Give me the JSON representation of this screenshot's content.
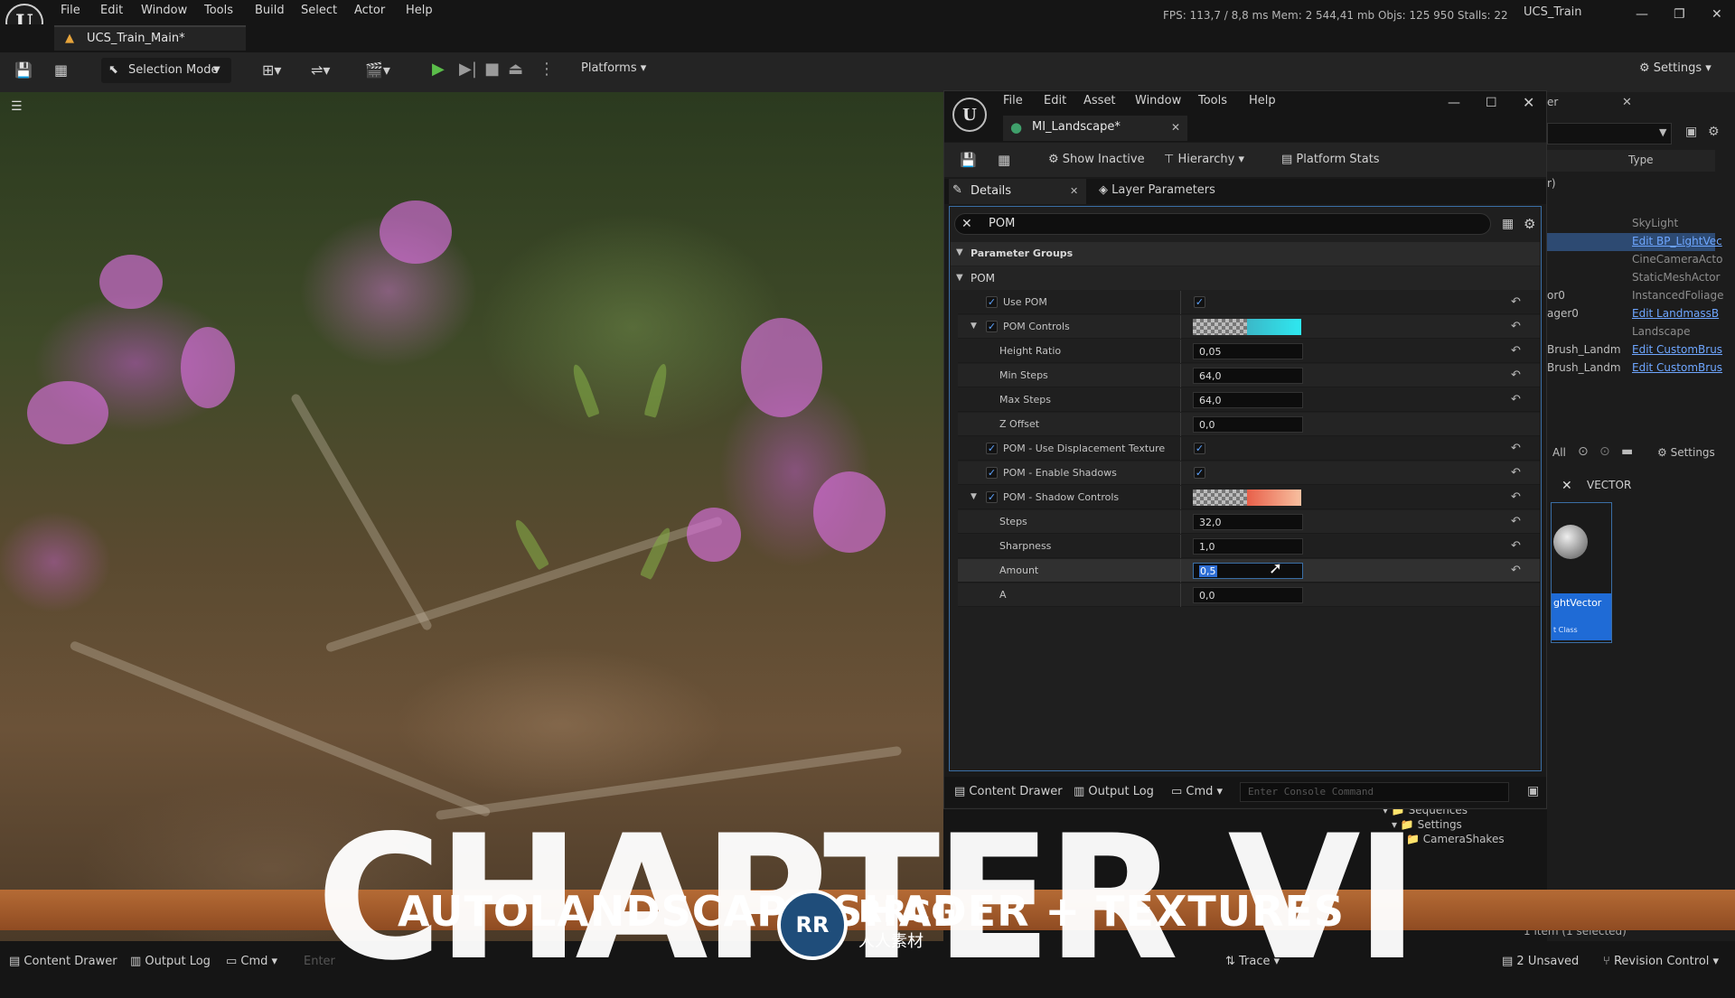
{
  "editor": {
    "menu": [
      "File",
      "Edit",
      "Window",
      "Tools",
      "Build",
      "Select",
      "Actor",
      "Help"
    ],
    "stats": "FPS: 113,7  /  8,8 ms   Mem: 2 544,41 mb   Objs: 125 950   Stalls: 22",
    "project_title": "UCS_Train",
    "level_tab": "UCS_Train_Main*",
    "selection_mode": "Selection Mode",
    "platforms": "Platforms",
    "settings": "Settings"
  },
  "material_editor": {
    "menu": [
      "File",
      "Edit",
      "Asset",
      "Window",
      "Tools",
      "Help"
    ],
    "tab_title": "MI_Landscape*",
    "toolbar": {
      "show_inactive": "Show Inactive",
      "hierarchy": "Hierarchy",
      "platform_stats": "Platform Stats"
    },
    "panel_tabs": {
      "details": "Details",
      "layer_parameters": "Layer Parameters"
    },
    "search": "POM",
    "group_header": "Parameter Groups",
    "group": "POM",
    "params": [
      {
        "label": "Use POM",
        "checked": true,
        "value_checked": true,
        "kind": "bool"
      },
      {
        "label": "POM Controls",
        "checked": true,
        "kind": "color",
        "color": "#23d6e6"
      },
      {
        "label": "Height Ratio",
        "value": "0,05",
        "kind": "num"
      },
      {
        "label": "Min Steps",
        "value": "64,0",
        "kind": "num"
      },
      {
        "label": "Max Steps",
        "value": "64,0",
        "kind": "num"
      },
      {
        "label": "Z Offset",
        "value": "0,0",
        "kind": "num"
      },
      {
        "label": "POM - Use Displacement Texture",
        "checked": true,
        "value_checked": true,
        "kind": "bool"
      },
      {
        "label": "POM - Enable Shadows",
        "checked": true,
        "value_checked": true,
        "kind": "bool"
      },
      {
        "label": "POM - Shadow Controls",
        "checked": true,
        "kind": "color",
        "color": "#f08060"
      },
      {
        "label": "Steps",
        "value": "32,0",
        "kind": "num"
      },
      {
        "label": "Sharpness",
        "value": "1,0",
        "kind": "num"
      },
      {
        "label": "Amount",
        "value": "0,5",
        "kind": "num"
      },
      {
        "label": "A",
        "value": "0,0",
        "kind": "num"
      }
    ],
    "bottom": {
      "content_drawer": "Content Drawer",
      "output_log": "Output Log",
      "cmd": "Cmd",
      "console_placeholder": "Enter Console Command"
    }
  },
  "outliner": {
    "type_header": "Type",
    "rows": [
      {
        "name": "r)",
        "type": ""
      },
      {
        "name": "",
        "type": "SkyLight"
      },
      {
        "name": "",
        "type": "Edit BP_LightVec"
      },
      {
        "name": "",
        "type": "CineCameraActo"
      },
      {
        "name": "",
        "type": "StaticMeshActor"
      },
      {
        "name": "or0",
        "type": "InstancedFoliage"
      },
      {
        "name": "ager0",
        "type": "Edit LandmassB"
      },
      {
        "name": "",
        "type": "Landscape"
      },
      {
        "name": "Brush_Landm",
        "type": "Edit CustomBrus"
      },
      {
        "name": "Brush_Landm",
        "type": "Edit CustomBrus"
      }
    ],
    "filter_all": "All",
    "filter_settings": "Settings",
    "vector_search": "VECTOR",
    "asset_label": "ghtVector",
    "asset_sub": "t Class",
    "tree": [
      "Sequences",
      "Settings",
      "CameraShakes"
    ],
    "selection_count": "1 item (1 selected)"
  },
  "overlay": {
    "chapter": "CHAPTER VI",
    "subtitle": "AUTOLANDSCAPE SHADER + TEXTURES",
    "watermark": "RRCG",
    "watermark_sub": "人人素材"
  },
  "statusbar": {
    "content_drawer": "Content Drawer",
    "output_log": "Output Log",
    "cmd": "Cmd",
    "console": "Enter",
    "trace": "Trace",
    "unsaved": "2 Unsaved",
    "revision": "Revision Control"
  }
}
